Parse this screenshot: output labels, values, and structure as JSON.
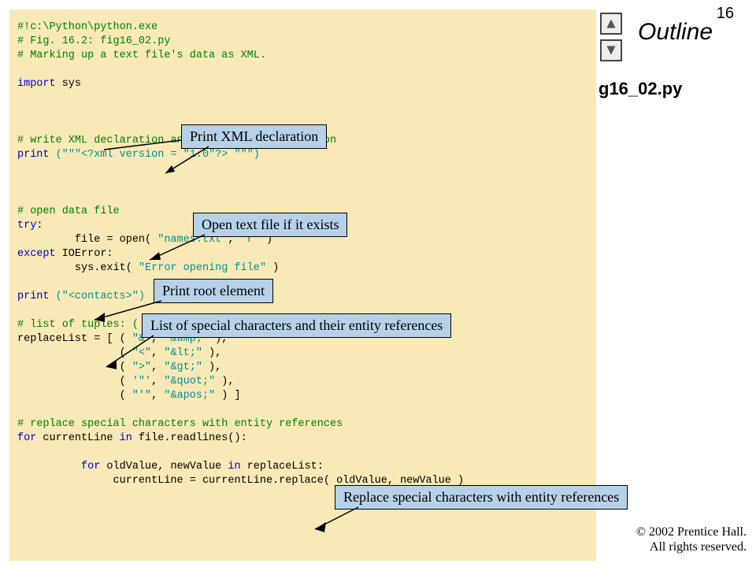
{
  "page_number": "16",
  "outline_label": "Outline",
  "side_filename": "g16_02.py",
  "copyright_line1": "© 2002 Prentice Hall.",
  "copyright_line2": "All rights reserved.",
  "code": {
    "l01": "#!c:\\Python\\python.exe",
    "l02": "# Fig. 16.2: fig16_02.py",
    "l03": "# Marking up a text file's data as XML.",
    "l04_import": "import",
    "l04_sys": " sys",
    "l05": "# write XML declaration and processing instruction",
    "l06_print": "print",
    "l06_rest": " (\"\"\"<?xml version = \"1.0\"?> \"\"\")",
    "l07": "# open data file",
    "l08_try": "try",
    "l08_colon": ":",
    "l09a": "         file = open( ",
    "l09b": "\"names.txt\"",
    "l09c": ", ",
    "l09d": "\"r\"",
    "l09e": " )",
    "l10_except": "except",
    "l10_ioerror": " IOError:",
    "l11a": "         sys.exit( ",
    "l11b": "\"Error opening file\"",
    "l11c": " )",
    "l12_print": "print",
    "l12_rest": " (\"<contacts>\")",
    "l13": "# list of tuples: ( special character, entity reference )",
    "l14a": "replaceList = [ ( ",
    "l14b": "\"&\"",
    "l14c": ", ",
    "l14d": "\"&amp;\"",
    "l14e": " ),",
    "l15a": "                ( ",
    "l15b": "\"<\"",
    "l15c": ", ",
    "l15d": "\"&lt;\"",
    "l15e": " ),",
    "l16a": "                ( ",
    "l16b": "\">\"",
    "l16c": ", ",
    "l16d": "\"&gt;\"",
    "l16e": " ),",
    "l17a": "                ( ",
    "l17b": "'\"'",
    "l17c": ", ",
    "l17d": "\"&quot;\"",
    "l17e": " ),",
    "l18a": "                ( ",
    "l18b": "\"'\"",
    "l18c": ", ",
    "l18d": "\"&apos;\"",
    "l18e": " ) ]",
    "l19": "# replace special characters with entity references",
    "l20_for": "for",
    "l20_mid": " currentLine ",
    "l20_in": "in",
    "l20_end": " file.readlines():",
    "l21_ind": "          ",
    "l21_for": "for",
    "l21_mid": " oldValue, newValue ",
    "l21_in": "in",
    "l21_end": " replaceList:",
    "l22": "               currentLine = currentLine.replace( oldValue, newValue )"
  },
  "callouts": {
    "c1": "Print XML declaration",
    "c2": "Open text file if it exists",
    "c3": "Print root element",
    "c4": "List of special characters and their entity references",
    "c5": "Replace special characters with entity references"
  }
}
